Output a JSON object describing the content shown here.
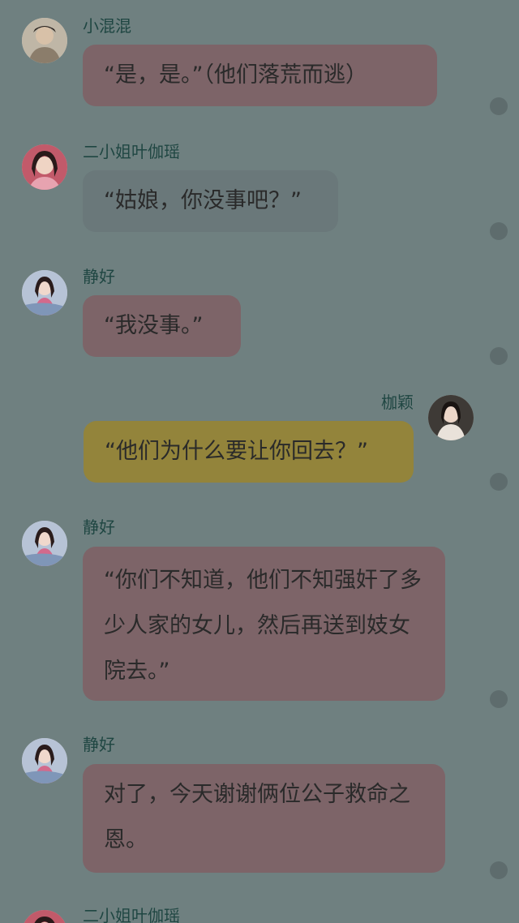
{
  "messages": [
    {
      "name": "小混混",
      "text": "“是，是。”（他们落荒而逃）",
      "side": "left",
      "color": "pink",
      "avatar": "man-avatar"
    },
    {
      "name": "二小姐叶伽瑶",
      "text": "“姑娘，你没事吧？”",
      "side": "left",
      "color": "gray",
      "avatar": "lady-avatar"
    },
    {
      "name": "静好",
      "text": "“我没事。”",
      "side": "left",
      "color": "pink",
      "avatar": "jinghao-avatar"
    },
    {
      "name": "枷颖",
      "text": "“他们为什么要让你回去？”",
      "side": "right",
      "color": "gold",
      "avatar": "jiaying-avatar"
    },
    {
      "name": "静好",
      "text": "“你们不知道，他们不知强奸了多少人家的女儿，然后再送到妓女院去。”",
      "side": "left",
      "color": "pink",
      "avatar": "jinghao-avatar"
    },
    {
      "name": "静好",
      "text": "对了，今天谢谢俩位公子救命之恩。",
      "side": "left",
      "color": "pink",
      "avatar": "jinghao-avatar"
    },
    {
      "name": "二小姐叶伽瑶",
      "text": "",
      "side": "left",
      "color": "gray",
      "avatar": "lady-avatar"
    }
  ]
}
